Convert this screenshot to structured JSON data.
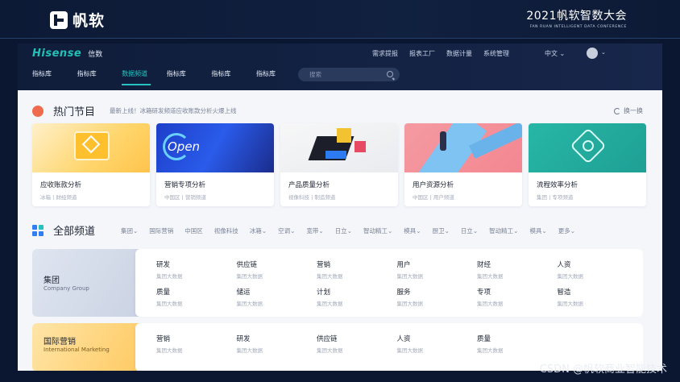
{
  "slide": {
    "logo_text": "帆软",
    "conf_title": "2021帆软智数大会",
    "conf_subtitle": "FAN RUAN INTELLIGENT DATA CONFERENCE",
    "watermark": "CSDN @帆软商业智能技术"
  },
  "brand": {
    "name": "Hisense",
    "sub": "信数"
  },
  "toplinks": [
    "需求提报",
    "报表工厂",
    "数据计量",
    "系统管理"
  ],
  "language": "中文",
  "tabs": [
    {
      "label": "指标库",
      "active": false
    },
    {
      "label": "指标库",
      "active": false
    },
    {
      "label": "数据频道",
      "active": true
    },
    {
      "label": "指标库",
      "active": false
    },
    {
      "label": "指标库",
      "active": false
    },
    {
      "label": "指标库",
      "active": false
    }
  ],
  "search": {
    "placeholder": "搜索"
  },
  "hot": {
    "title": "热门节目",
    "news": "最新上线！冰箱研发频道应收账款分析火爆上线",
    "refresh": "换一换",
    "cards": [
      {
        "title": "应收账款分析",
        "tags": "冰箱 | 财经频道"
      },
      {
        "title": "营销专项分析",
        "tags": "中国区 | 营销频道"
      },
      {
        "title": "产品质量分析",
        "tags": "视像科技 | 制造频道"
      },
      {
        "title": "用户资源分析",
        "tags": "中国区 | 用户频道"
      },
      {
        "title": "流程效率分析",
        "tags": "集团 | 专项频道"
      }
    ]
  },
  "all": {
    "title": "全部频道",
    "filters": [
      "集团",
      "国际营销",
      "中国区",
      "视像科技",
      "冰箱",
      "空调",
      "宽带",
      "日立",
      "智动精工",
      "模具",
      "厨卫",
      "日立",
      "智动精工",
      "模具",
      "更多"
    ],
    "groups": [
      {
        "name": "集团",
        "en": "Company Group",
        "items": [
          {
            "t": "研发",
            "s": "集团大数据"
          },
          {
            "t": "供应链",
            "s": "集团大数据"
          },
          {
            "t": "营销",
            "s": "集团大数据"
          },
          {
            "t": "用户",
            "s": "集团大数据"
          },
          {
            "t": "财经",
            "s": "集团大数据"
          },
          {
            "t": "人资",
            "s": "集团大数据"
          },
          {
            "t": "质量",
            "s": "集团大数据"
          },
          {
            "t": "储运",
            "s": "集团大数据"
          },
          {
            "t": "计划",
            "s": "集团大数据"
          },
          {
            "t": "服务",
            "s": "集团大数据"
          },
          {
            "t": "专项",
            "s": "集团大数据"
          },
          {
            "t": "智造",
            "s": "集团大数据"
          }
        ]
      },
      {
        "name": "国际营销",
        "en": "International Marketing",
        "items": [
          {
            "t": "营销",
            "s": "集团大数据"
          },
          {
            "t": "研发",
            "s": "集团大数据"
          },
          {
            "t": "供应链",
            "s": "集团大数据"
          },
          {
            "t": "人资",
            "s": "集团大数据"
          },
          {
            "t": "质量",
            "s": "集团大数据"
          }
        ]
      }
    ]
  },
  "colors": {
    "accent": "#27c1c0",
    "brand": "#21c1b5",
    "nav_bg": "#0f1d3a"
  }
}
